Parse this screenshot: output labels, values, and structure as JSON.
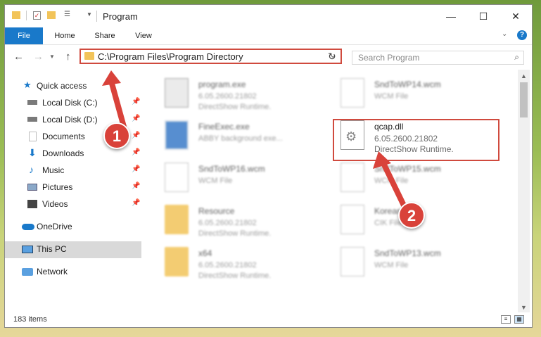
{
  "window": {
    "title": "Program"
  },
  "ribbon": {
    "tabs": [
      "File",
      "Home",
      "Share",
      "View"
    ]
  },
  "address": {
    "path": "C:\\Program Files\\Program Directory",
    "search_placeholder": "Search Program"
  },
  "nav": {
    "quick_access": "Quick access",
    "items": [
      "Local Disk (C:)",
      "Local Disk (D:)",
      "Documents",
      "Downloads",
      "Music",
      "Pictures",
      "Videos"
    ],
    "onedrive": "OneDrive",
    "thispc": "This PC",
    "network": "Network"
  },
  "files": [
    {
      "name": "program.exe",
      "line2": "6.05.2600.21802",
      "line3": "DirectShow Runtime."
    },
    {
      "name": "SndToWP14.wcm",
      "line2": "WCM File",
      "line3": ""
    },
    {
      "name": "FineExec.exe",
      "line2": "ABBY background exe...",
      "line3": ""
    },
    {
      "name": "qcap.dll",
      "line2": "6.05.2600.21802",
      "line3": "DirectShow Runtime."
    },
    {
      "name": "SndToWP16.wcm",
      "line2": "WCM File",
      "line3": ""
    },
    {
      "name": "SndToWP15.wcm",
      "line2": "WCM File",
      "line3": ""
    },
    {
      "name": "Resource",
      "line2": "6.05.2600.21802",
      "line3": "DirectShow Runtime."
    },
    {
      "name": "Korean",
      "line2": "CIK File",
      "line3": ""
    },
    {
      "name": "x64",
      "line2": "6.05.2600.21802",
      "line3": "DirectShow Runtime."
    },
    {
      "name": "SndToWP13.wcm",
      "line2": "WCM File",
      "line3": ""
    }
  ],
  "status": {
    "count": "183 items"
  },
  "markers": [
    "1",
    "2"
  ],
  "colors": {
    "accent": "#1979ca",
    "highlight": "#d04a3e",
    "marker": "#d9423a"
  }
}
